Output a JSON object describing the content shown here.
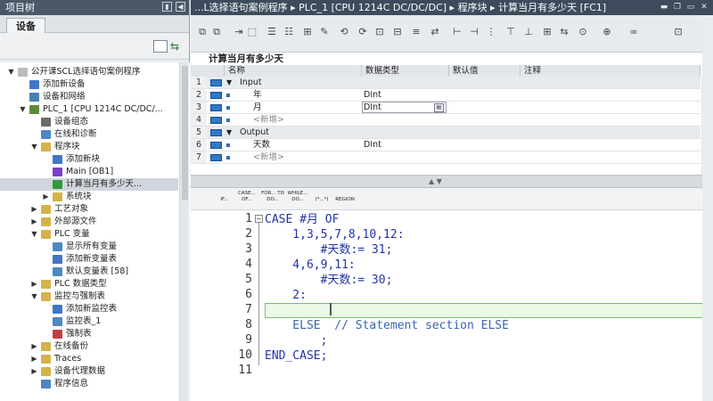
{
  "left_panel": {
    "title": "项目树",
    "tab": "设备",
    "tree": [
      {
        "label": "公开课SCL选择语句案例程序",
        "level": 0
      },
      {
        "label": "添加新设备",
        "level": 1
      },
      {
        "label": "设备和网络",
        "level": 1
      },
      {
        "label": "PLC_1 [CPU 1214C DC/DC/...",
        "level": 1
      },
      {
        "label": "设备组态",
        "level": 2
      },
      {
        "label": "在线和诊断",
        "level": 2
      },
      {
        "label": "程序块",
        "level": 2
      },
      {
        "label": "添加新块",
        "level": 3
      },
      {
        "label": "Main [OB1]",
        "level": 3
      },
      {
        "label": "计算当月有多少天...",
        "level": 3
      },
      {
        "label": "系统块",
        "level": 3
      },
      {
        "label": "工艺对象",
        "level": 2
      },
      {
        "label": "外部源文件",
        "level": 2
      },
      {
        "label": "PLC 变量",
        "level": 2
      },
      {
        "label": "显示所有变量",
        "level": 3
      },
      {
        "label": "添加新变量表",
        "level": 3
      },
      {
        "label": "默认变量表 [58]",
        "level": 3
      },
      {
        "label": "PLC 数据类型",
        "level": 2
      },
      {
        "label": "监控与强制表",
        "level": 2
      },
      {
        "label": "添加新监控表",
        "level": 3
      },
      {
        "label": "监控表_1",
        "level": 3
      },
      {
        "label": "强制表",
        "level": 3
      },
      {
        "label": "在线备份",
        "level": 2
      },
      {
        "label": "Traces",
        "level": 2
      },
      {
        "label": "设备代理数据",
        "level": 2
      },
      {
        "label": "程序信息",
        "level": 2
      }
    ]
  },
  "editor": {
    "title": "...L选择语句案例程序 ▸ PLC_1 [CPU 1214C DC/DC/DC] ▸ 程序块 ▸ 计算当月有多少天 [FC1]",
    "block_name": "计算当月有多少天",
    "interface_headers": [
      "名称",
      "数据类型",
      "默认值",
      "注释"
    ],
    "interface_rows": [
      {
        "num": "1",
        "name": "Input",
        "type": "",
        "section": true
      },
      {
        "num": "2",
        "name": "年",
        "type": "DInt",
        "section": false
      },
      {
        "num": "3",
        "name": "月",
        "type": "DInt",
        "section": false
      },
      {
        "num": "4",
        "name": "<新增>",
        "type": "",
        "section": false
      },
      {
        "num": "5",
        "name": "Output",
        "type": "",
        "section": true
      },
      {
        "num": "6",
        "name": "天数",
        "type": "DInt",
        "section": false
      },
      {
        "num": "7",
        "name": "<新增>",
        "type": "",
        "section": false
      }
    ],
    "instructions": [
      "IF...",
      "CASE... OF...",
      "FOR... TO DO...",
      "WHILE... DO...",
      "(*...*)",
      "REGION"
    ],
    "code_lines": [
      {
        "num": "1",
        "text": "CASE #月 OF"
      },
      {
        "num": "2",
        "text": "    1,3,5,7,8,10,12:"
      },
      {
        "num": "3",
        "text": "        #天数:= 31;"
      },
      {
        "num": "4",
        "text": "    4,6,9,11:"
      },
      {
        "num": "5",
        "text": "        #天数:= 30;"
      },
      {
        "num": "6",
        "text": "    2:"
      },
      {
        "num": "7",
        "text": ""
      },
      {
        "num": "8",
        "text": "    ELSE  // Statement section ELSE"
      },
      {
        "num": "9",
        "text": "        ;"
      },
      {
        "num": "10",
        "text": "END_CASE;"
      },
      {
        "num": "11",
        "text": ""
      }
    ]
  }
}
